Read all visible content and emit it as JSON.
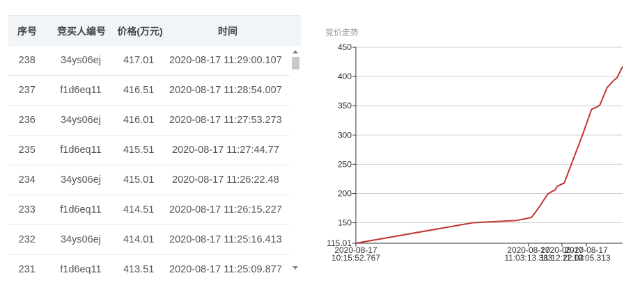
{
  "table": {
    "headers": [
      "序号",
      "竞买人编号",
      "价格(万元)",
      "时间"
    ],
    "rows": [
      [
        "238",
        "34ys06ej",
        "417.01",
        "2020-08-17 11:29:00.107"
      ],
      [
        "237",
        "f1d6eq11",
        "416.51",
        "2020-08-17 11:28:54.007"
      ],
      [
        "236",
        "34ys06ej",
        "416.01",
        "2020-08-17 11:27:53.273"
      ],
      [
        "235",
        "f1d6eq11",
        "415.51",
        "2020-08-17 11:27:44.77"
      ],
      [
        "234",
        "34ys06ej",
        "415.01",
        "2020-08-17 11:26:22.48"
      ],
      [
        "233",
        "f1d6eq11",
        "414.51",
        "2020-08-17 11:26:15.227"
      ],
      [
        "232",
        "34ys06ej",
        "414.01",
        "2020-08-17 11:25:16.413"
      ],
      [
        "231",
        "f1d6eq11",
        "413.51",
        "2020-08-17 11:25:09.877"
      ]
    ]
  },
  "chart_data": {
    "type": "line",
    "title": "竞价走势",
    "xlabel": "",
    "ylabel": "",
    "ylim": [
      115.01,
      450
    ],
    "y_ticks": [
      "115.01",
      "150",
      "200",
      "250",
      "300",
      "350",
      "400",
      "450"
    ],
    "x_tick_labels": [
      [
        "2020-08-17",
        "10:15:52.767"
      ],
      [
        "2020-08-17",
        "11:03:13.383"
      ],
      [
        "2020-08-17",
        "11:12:22.03"
      ],
      [
        "2020-08-17",
        "11:19:05.313"
      ]
    ],
    "series": [
      {
        "color": "#c23531",
        "points": [
          [
            "10:15:52.767",
            115.01
          ],
          [
            "10:48:00.000",
            150.0
          ],
          [
            "11:00:00.000",
            154.0
          ],
          [
            "11:04:00.000",
            159.0
          ],
          [
            "11:05:00.000",
            167.0
          ],
          [
            "11:06:30.000",
            180.0
          ],
          [
            "11:07:30.000",
            190.0
          ],
          [
            "11:08:30.000",
            199.0
          ],
          [
            "11:09:30.000",
            203.0
          ],
          [
            "11:10:30.000",
            206.0
          ],
          [
            "11:11:00.000",
            212.0
          ],
          [
            "11:12:00.000",
            215.0
          ],
          [
            "11:13:00.000",
            218.0
          ],
          [
            "11:18:00.000",
            300.0
          ],
          [
            "11:20:30.000",
            344.0
          ],
          [
            "11:22:00.000",
            348.0
          ],
          [
            "11:22:45.000",
            351.0
          ],
          [
            "11:24:45.000",
            381.0
          ],
          [
            "11:25:30.000",
            386.0
          ],
          [
            "11:26:30.000",
            393.0
          ],
          [
            "11:27:30.000",
            398.0
          ],
          [
            "11:29:00.107",
            417.01
          ]
        ]
      }
    ]
  }
}
